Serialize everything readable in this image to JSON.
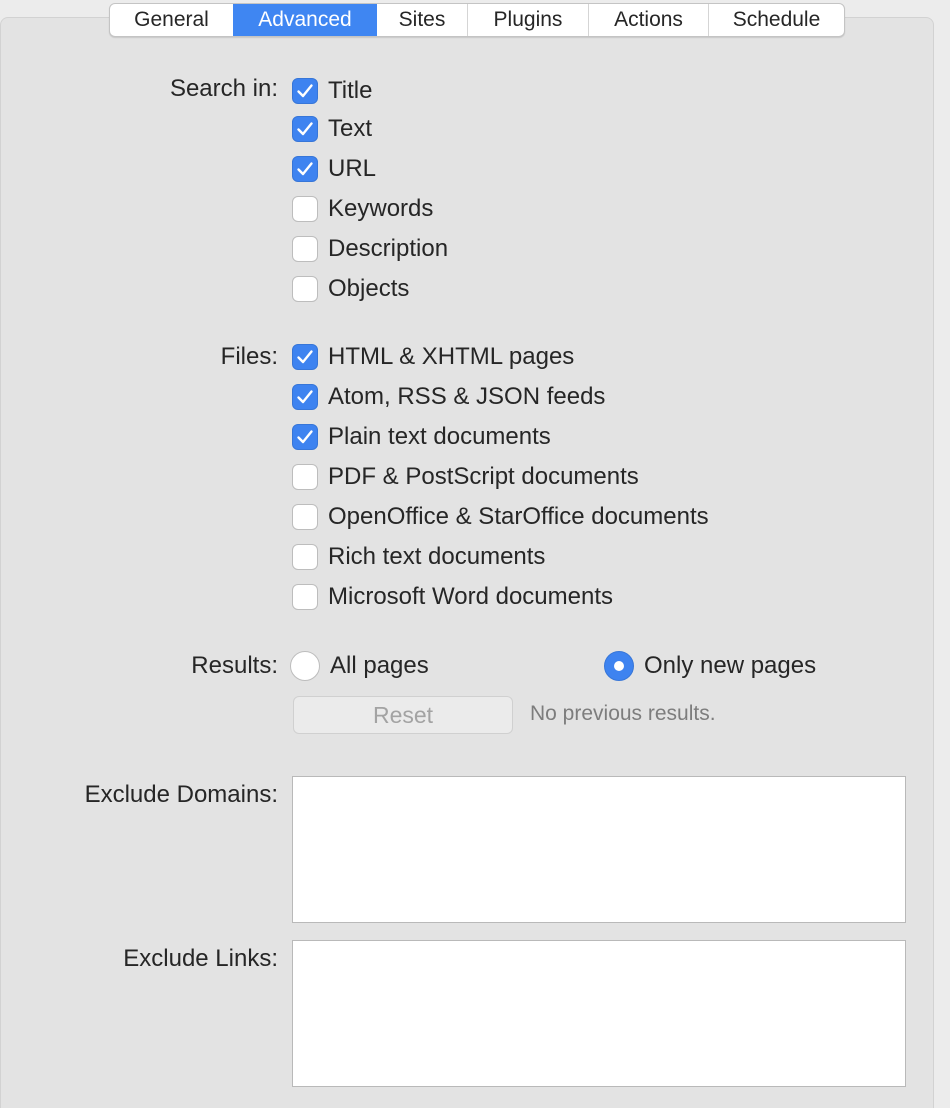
{
  "tabs": [
    {
      "label": "General",
      "active": false
    },
    {
      "label": "Advanced",
      "active": true
    },
    {
      "label": "Sites",
      "active": false
    },
    {
      "label": "Plugins",
      "active": false
    },
    {
      "label": "Actions",
      "active": false
    },
    {
      "label": "Schedule",
      "active": false
    }
  ],
  "search_in": {
    "label": "Search in:",
    "options": [
      {
        "label": "Title",
        "checked": true
      },
      {
        "label": "Text",
        "checked": true
      },
      {
        "label": "URL",
        "checked": true
      },
      {
        "label": "Keywords",
        "checked": false
      },
      {
        "label": "Description",
        "checked": false
      },
      {
        "label": "Objects",
        "checked": false
      }
    ]
  },
  "files": {
    "label": "Files:",
    "options": [
      {
        "label": "HTML & XHTML pages",
        "checked": true
      },
      {
        "label": "Atom, RSS & JSON feeds",
        "checked": true
      },
      {
        "label": "Plain text documents",
        "checked": true
      },
      {
        "label": "PDF & PostScript documents",
        "checked": false
      },
      {
        "label": "OpenOffice & StarOffice documents",
        "checked": false
      },
      {
        "label": "Rich text documents",
        "checked": false
      },
      {
        "label": "Microsoft Word documents",
        "checked": false
      }
    ]
  },
  "results": {
    "label": "Results:",
    "options": [
      {
        "label": "All pages",
        "selected": false
      },
      {
        "label": "Only new pages",
        "selected": true
      }
    ],
    "reset_label": "Reset",
    "status": "No previous results."
  },
  "exclude_domains": {
    "label": "Exclude Domains:",
    "value": ""
  },
  "exclude_links": {
    "label": "Exclude Links:",
    "value": ""
  },
  "colors": {
    "accent": "#3e83f0",
    "tab_active": "#3f86f2",
    "pane_background": "#e3e3e3"
  }
}
